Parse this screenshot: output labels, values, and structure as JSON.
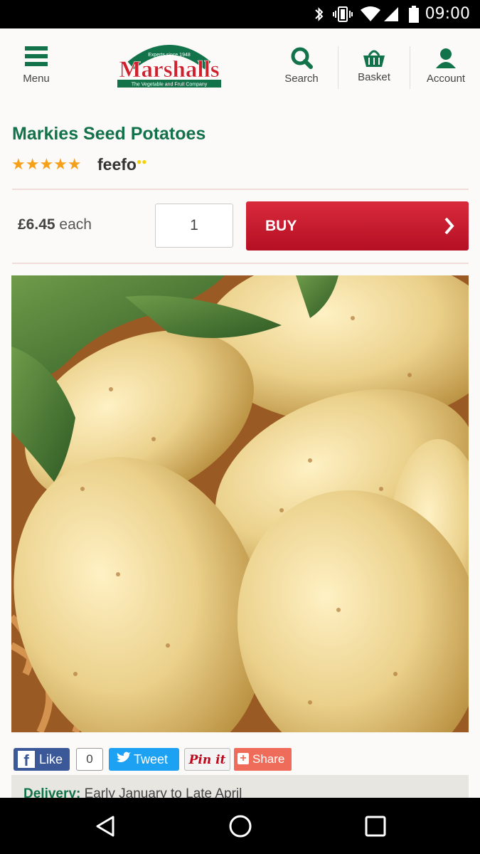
{
  "status_bar": {
    "time": "09:00"
  },
  "header": {
    "menu_label": "Menu",
    "logo": {
      "name": "Marshalls",
      "top_text": "Experts since 1948",
      "tagline": "The Vegetable and Fruit Company"
    },
    "search_label": "Search",
    "basket_label": "Basket",
    "account_label": "Account"
  },
  "product": {
    "title": "Markies Seed Potatoes",
    "rating_stars": 5,
    "stars_text": "★★★★★",
    "review_brand": "feefo",
    "price": "£6.45",
    "price_unit": "each",
    "quantity": "1",
    "buy_label": "BUY",
    "image_alt": "Markies seed potatoes"
  },
  "social": {
    "like_label": "Like",
    "like_count": "0",
    "tweet_label": "Tweet",
    "pin_label": "Pin it",
    "share_label": "Share"
  },
  "delivery": {
    "label": "Delivery:",
    "value": "Early January to Late April"
  },
  "colors": {
    "brand_green": "#12724a",
    "buy_red": "#c8192e",
    "star_orange": "#f6a01a"
  }
}
